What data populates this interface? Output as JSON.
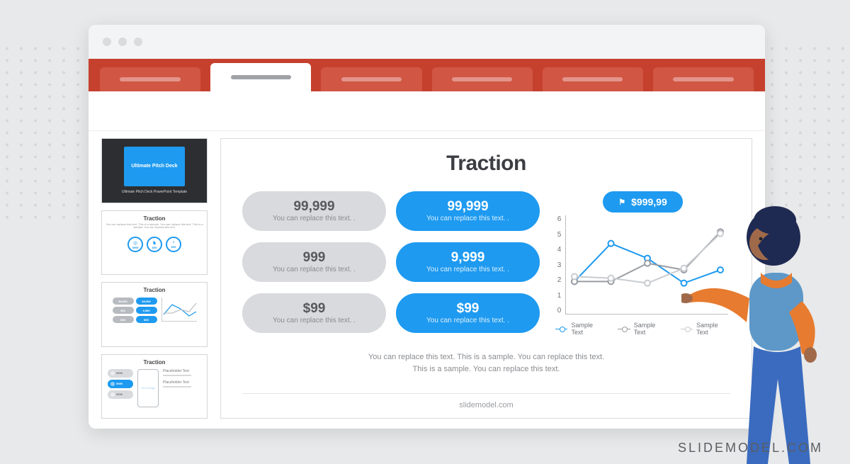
{
  "thumb1": {
    "title": "Ultimate Pitch Deck",
    "subtitle": "Ultimate Pitch Deck PowerPoint Template"
  },
  "thumb2": {
    "title": "Traction",
    "subtitle": "You can replace this text. This is a sample. You can replace this text. This is a sample. You can replace this text.",
    "chips": [
      {
        "icon": "◎",
        "value": "9999"
      },
      {
        "icon": "♞",
        "value": "$99"
      },
      {
        "icon": "♀",
        "value": "$99"
      }
    ]
  },
  "thumb3": {
    "title": "Traction",
    "pills": [
      "$9,999",
      "$9,999",
      "999",
      "9,999",
      "$99",
      "$99"
    ]
  },
  "thumb4": {
    "title": "Traction",
    "pills": [
      "9999",
      "9999",
      "9999"
    ],
    "phone": "Your Image",
    "placeholders": [
      "Placeholder Text",
      "Placeholder Text"
    ]
  },
  "slide": {
    "title": "Traction",
    "badge": "$999,99",
    "pills": [
      {
        "value": "99,999",
        "sub": "You can replace this text. .",
        "tone": "gray"
      },
      {
        "value": "99,999",
        "sub": "You can replace this text. .",
        "tone": "blue"
      },
      {
        "value": "999",
        "sub": "You can replace this text. .",
        "tone": "gray"
      },
      {
        "value": "9,999",
        "sub": "You can replace this text. .",
        "tone": "blue"
      },
      {
        "value": "$99",
        "sub": "You can replace this text. .",
        "tone": "gray"
      },
      {
        "value": "$99",
        "sub": "You can replace this text. .",
        "tone": "blue"
      }
    ],
    "legend": [
      "Sample Text",
      "Sample Text",
      "Sample Text"
    ],
    "caption1": "You can replace this text. This is a sample. You can replace this text.",
    "caption2": "This is a sample. You can replace this text.",
    "footer": "slidemodel.com"
  },
  "chart_data": {
    "type": "line",
    "x": [
      1,
      2,
      3,
      4,
      5
    ],
    "ylim": [
      0,
      6
    ],
    "yticks": [
      0,
      1,
      2,
      3,
      4,
      5,
      6
    ],
    "series": [
      {
        "name": "Sample Text",
        "color": "#1e9af0",
        "values": [
          2.0,
          4.3,
          3.4,
          1.9,
          2.7
        ]
      },
      {
        "name": "Sample Text",
        "color": "#9a9da2",
        "values": [
          2.0,
          2.0,
          3.1,
          2.7,
          5.0
        ]
      },
      {
        "name": "Sample Text",
        "color": "#c9ccd0",
        "values": [
          2.3,
          2.2,
          1.9,
          2.8,
          4.9
        ]
      }
    ]
  },
  "brand": "SLIDEMODEL.COM"
}
